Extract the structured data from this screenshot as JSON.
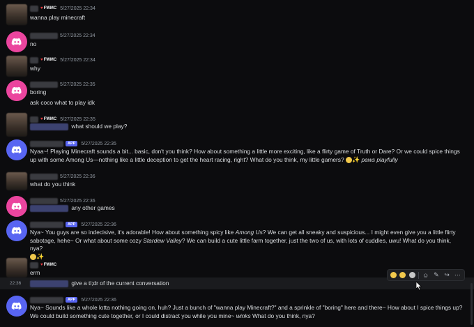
{
  "messages": [
    {
      "id": "m1",
      "tag": "FWMC",
      "time": "5/27/2025 22:34",
      "text": "wanna play minecraft"
    },
    {
      "id": "m2",
      "time": "5/27/2025 22:34",
      "text": "no"
    },
    {
      "id": "m3",
      "tag": "FWMC",
      "time": "5/27/2025 22:34",
      "text": "why"
    },
    {
      "id": "m4",
      "time": "5/27/2025 22:35",
      "line1": "boring",
      "line2": "ask coco what to play idk"
    },
    {
      "id": "m5",
      "tag": "FWMC",
      "time": "5/27/2025 22:35",
      "text": "what should we play?"
    },
    {
      "id": "m6",
      "badge": "APP",
      "time": "5/27/2025 22:35",
      "text": "Nyaa~! Playing Minecraft sounds a bit... basic, don't you think? How about something a little more exciting, like a flirty game of Truth or Dare? Or we could spice things up with some Among Us—nothing like a little deception to get the heart racing, right? What do you think, my little gamers?",
      "action": "paws playfully"
    },
    {
      "id": "m7",
      "time": "5/27/2025 22:36",
      "text": "what do you think"
    },
    {
      "id": "m8",
      "time": "5/27/2025 22:36",
      "text": "any other games"
    },
    {
      "id": "m9",
      "badge": "APP",
      "time": "5/27/2025 22:36",
      "part1": "Nya~ You guys are so indecisive, it's adorable! How about something spicy like ",
      "em1": "Among Us",
      "part2": "? We can get all sneaky and suspicious... I might even give you a little flirty sabotage, hehe~ Or what about some cozy ",
      "em2": "Stardew Valley",
      "part3": "? We can build a cute little farm together, just the two of us, with lots of cuddles, uwu! What do you think, nya?"
    },
    {
      "id": "m10",
      "tag": "FWMC",
      "text": "erm"
    },
    {
      "id": "m11",
      "side_time": "22:36",
      "text": "give a tl;dr of the current conversation"
    },
    {
      "id": "m12",
      "badge": "APP",
      "time": "5/27/2025 22:36",
      "part1": "Nya~ Sounds like a whole lotta nothing going on, huh? Just a bunch of \"wanna play Minecraft?\" and a sprinkle of \"boring\" here and there~ How about I spice things up? We could build something cute together, or I could distract you while you mine~ ",
      "em1": "winks",
      "part2": " What do you think, nya?"
    }
  ],
  "icons": {
    "discord": "discord-logo-icon",
    "toolbar": [
      "reaction-sad-icon",
      "reaction-laugh-icon",
      "reaction-skull-icon",
      "add-reaction-icon",
      "edit-icon",
      "reply-icon",
      "more-icon"
    ]
  },
  "colors": {
    "accent": "#5865f2",
    "pink": "#eb459e",
    "background": "#0c0c0e"
  }
}
